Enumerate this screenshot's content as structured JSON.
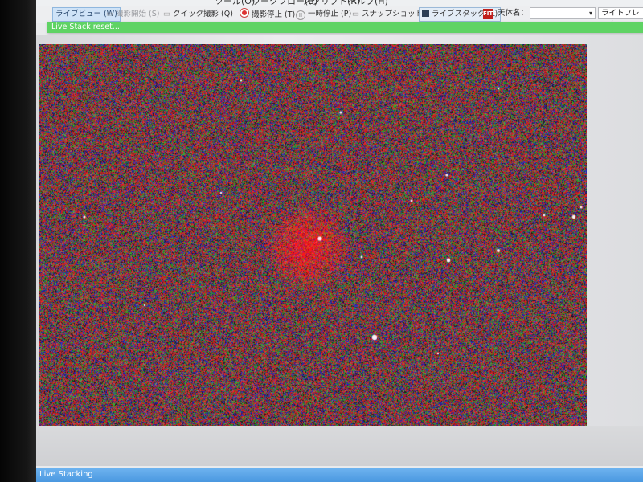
{
  "menubar": {
    "items": [
      "ツール(O)",
      "ワークフロー(B)",
      "スクリプト(R)",
      "ヘルプ(H)"
    ]
  },
  "toolbar": {
    "live_view": "ライブビュー (W)",
    "start_capture": "撮影開始 (S)",
    "quick_capture": "クイック撮影 (Q)",
    "stop_capture": "撮影停止 (T)",
    "pause": "一時停止 (P)",
    "snapshot": "スナップショット (A)",
    "live_stack": "ライブスタック (L)",
    "fits_icon": "FITS",
    "object_label": "天体名：",
    "object_value": "",
    "frame_type": "ライトフレーム"
  },
  "status": {
    "message": "Live Stack reset..."
  },
  "bottom": {
    "tab_label": "Live Stacking"
  },
  "colors": {
    "status_green": "#5fd364",
    "active_blue": "#cfe3f7",
    "tab_blue": "#4a98e0"
  },
  "icons": [
    "record-stop-icon",
    "pause-icon",
    "snapshot-icon",
    "live-stack-icon",
    "fits-icon",
    "chevron-down-icon"
  ]
}
